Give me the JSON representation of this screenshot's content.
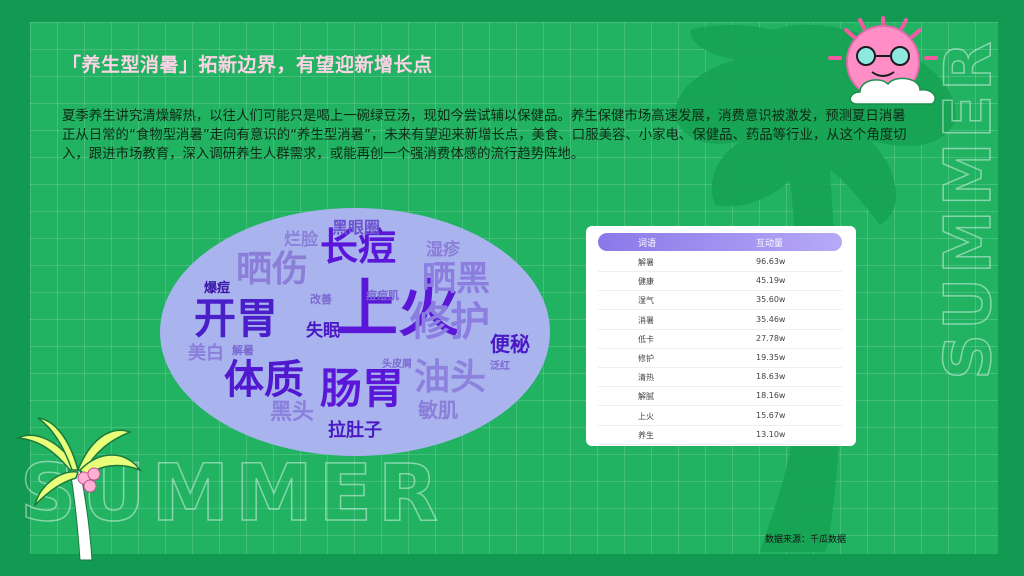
{
  "header": {
    "title": "「养生型消暑」拓新边界，有望迎新增长点"
  },
  "body": {
    "paragraph": "夏季养生讲究清燥解热，以往人们可能只是喝上一碗绿豆汤，现如今尝试辅以保健品。养生保健市场高速发展，消费意识被激发，预测夏日消暑正从日常的“食物型消暑”走向有意识的“养生型消暑”，未来有望迎来新增长点，美食、口服美容、小家电、保健品、药品等行业，从这个角度切入，跟进市场教育，深入调研养生人群需求，或能再创一个强消费体感的流行趋势阵地。"
  },
  "decor": {
    "summer_text_bottom": "SUMMER",
    "summer_text_right": "SUMMER"
  },
  "word_cloud": [
    {
      "text": "上火",
      "color": "#5a17d8"
    },
    {
      "text": "开胃",
      "color": "#4a1fc9"
    },
    {
      "text": "长痘",
      "color": "#5b16d9"
    },
    {
      "text": "晒伤",
      "color": "#8a7ed9"
    },
    {
      "text": "体质",
      "color": "#5019cf"
    },
    {
      "text": "肠胃",
      "color": "#5a17d8"
    },
    {
      "text": "修护",
      "color": "#8c7ee0"
    },
    {
      "text": "晒黑",
      "color": "#8b7ede"
    },
    {
      "text": "油头",
      "color": "#8c82de"
    },
    {
      "text": "黑头",
      "color": "#8b80db"
    },
    {
      "text": "黑眼圈",
      "color": "#6d54cf"
    },
    {
      "text": "湿疹",
      "color": "#8a7ed8"
    },
    {
      "text": "烂脸",
      "color": "#8c82db"
    },
    {
      "text": "爆痘",
      "color": "#3a16a8"
    },
    {
      "text": "失眠",
      "color": "#4a19c4"
    },
    {
      "text": "便秘",
      "color": "#4a19c4"
    },
    {
      "text": "美白",
      "color": "#8a7ed9"
    },
    {
      "text": "敏肌",
      "color": "#8a7ed9"
    },
    {
      "text": "拉肚子",
      "color": "#4a19c4"
    },
    {
      "text": "改善",
      "color": "#7a68d3"
    },
    {
      "text": "痘痘肌",
      "color": "#7a68d3"
    },
    {
      "text": "解暑",
      "color": "#7a68d3"
    },
    {
      "text": "头皮屑",
      "color": "#7a68d3"
    },
    {
      "text": "泛红",
      "color": "#7a68d3"
    }
  ],
  "table": {
    "headers": [
      "词语",
      "互动量"
    ],
    "rows": [
      [
        "解暑",
        "96.63w"
      ],
      [
        "健康",
        "45.19w"
      ],
      [
        "湿气",
        "35.60w"
      ],
      [
        "消暑",
        "35.46w"
      ],
      [
        "低卡",
        "27.78w"
      ],
      [
        "修护",
        "19.35w"
      ],
      [
        "清热",
        "18.63w"
      ],
      [
        "解腻",
        "18.16w"
      ],
      [
        "上火",
        "15.67w"
      ],
      [
        "养生",
        "13.10w"
      ]
    ]
  },
  "footer": {
    "source": "数据来源：千瓜数据"
  },
  "colors": {
    "background": "#139a52",
    "panel": "#21b262",
    "title": "#ffd3e6",
    "accent": "#8b78e9"
  }
}
